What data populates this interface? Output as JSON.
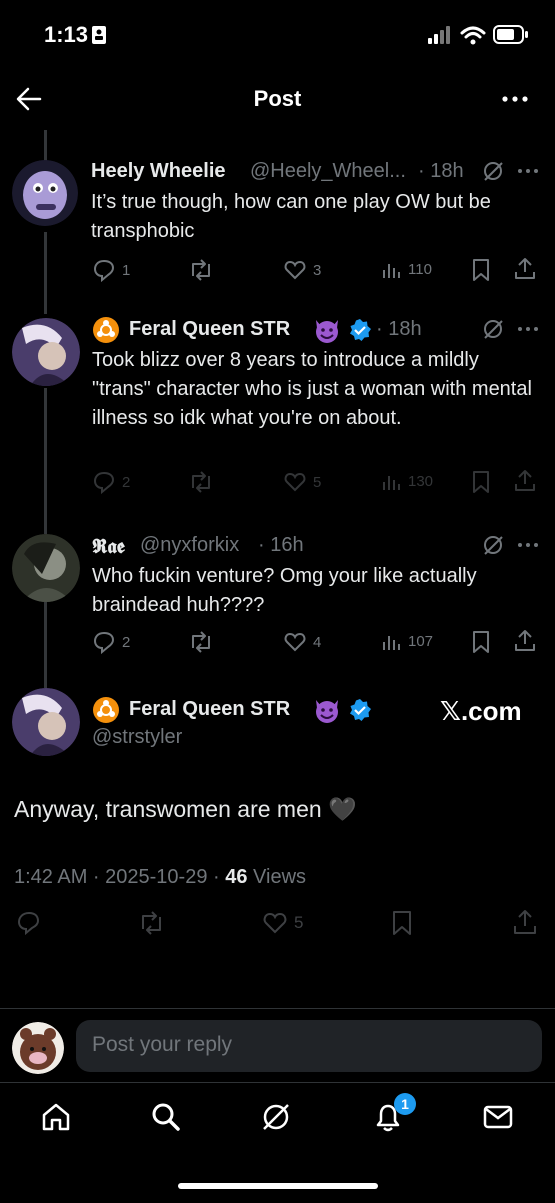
{
  "status_bar": {
    "time": "1:13"
  },
  "header": {
    "title": "Post"
  },
  "replies_above": [
    {
      "name": "Heely Wheelie",
      "handle": "@Heely_Wheel...",
      "time": "· 18h",
      "text": "It’s true though, how can one play OW but be transphobic",
      "counts": {
        "replies": "1",
        "likes": "3",
        "views": "110"
      }
    },
    {
      "name": "Feral Queen STR",
      "time": "· 18h",
      "text": "Took blizz over 8 years to introduce a mildly \"trans\" character who is just a woman with mental illness so idk what you're on about.",
      "counts": {
        "replies": "2",
        "likes": "5",
        "views": "130"
      }
    },
    {
      "name": "𝕽𝖆𝖊",
      "handle": "@nyxforkix",
      "time": "· 16h",
      "text": "Who fuckin venture? Omg your like actually braindead huh????",
      "counts": {
        "replies": "2",
        "likes": "4",
        "views": "107"
      }
    }
  ],
  "main_post": {
    "name": "Feral Queen STR",
    "handle": "@strstyler",
    "watermark": "𝕏.com",
    "text": "Anyway, transwomen are men 🖤",
    "meta_time": "1:42 AM · 2025-10-29 · ",
    "views_count": "46",
    "views_label": " Views",
    "likes": "5"
  },
  "reply_box": {
    "placeholder": "Post your reply"
  },
  "bottom_nav": {
    "notification_badge": "1"
  },
  "colors": {
    "background": "#000000",
    "accent_blue": "#1d9bf0",
    "secondary_text": "#71767b"
  }
}
